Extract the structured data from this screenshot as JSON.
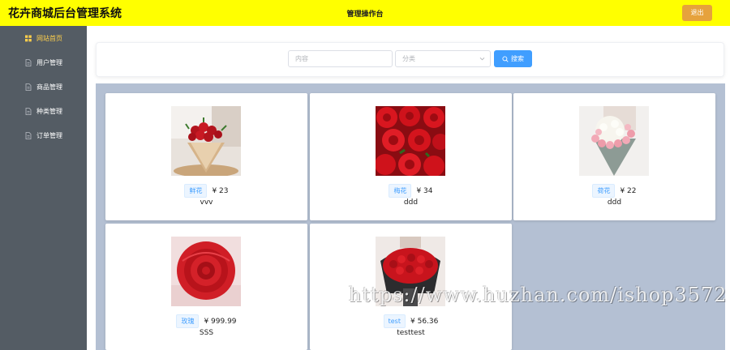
{
  "header": {
    "app_title": "花卉商城后台管理系统",
    "center_title": "管理操作台",
    "logout_label": "退出"
  },
  "sidebar": {
    "items": [
      {
        "label": "网站首页",
        "icon": "grid-icon",
        "active": true
      },
      {
        "label": "用户管理",
        "icon": "document-icon",
        "active": false
      },
      {
        "label": "商品管理",
        "icon": "document-icon",
        "active": false
      },
      {
        "label": "种类管理",
        "icon": "document-icon",
        "active": false
      },
      {
        "label": "订单管理",
        "icon": "document-icon",
        "active": false
      }
    ]
  },
  "search": {
    "content_placeholder": "内容",
    "category_placeholder": "分类",
    "button_label": "搜索"
  },
  "products": [
    {
      "tag": "鲜花",
      "price": "¥ 23",
      "name": "vvv"
    },
    {
      "tag": "梅花",
      "price": "¥ 34",
      "name": "ddd"
    },
    {
      "tag": "荷花",
      "price": "¥ 22",
      "name": "ddd"
    },
    {
      "tag": "玫瑰",
      "price": "¥ 999.99",
      "name": "SSS"
    },
    {
      "tag": "test",
      "price": "¥ 56.36",
      "name": "testtest"
    }
  ],
  "watermark": "https://www.huzhan.com/ishop3572",
  "colors": {
    "header_bg": "#ffff00",
    "sidebar_bg": "#545c64",
    "active_menu": "#ffd04b",
    "primary": "#409eff",
    "warning": "#e6a23c",
    "grid_bg": "#b4c0d3"
  }
}
